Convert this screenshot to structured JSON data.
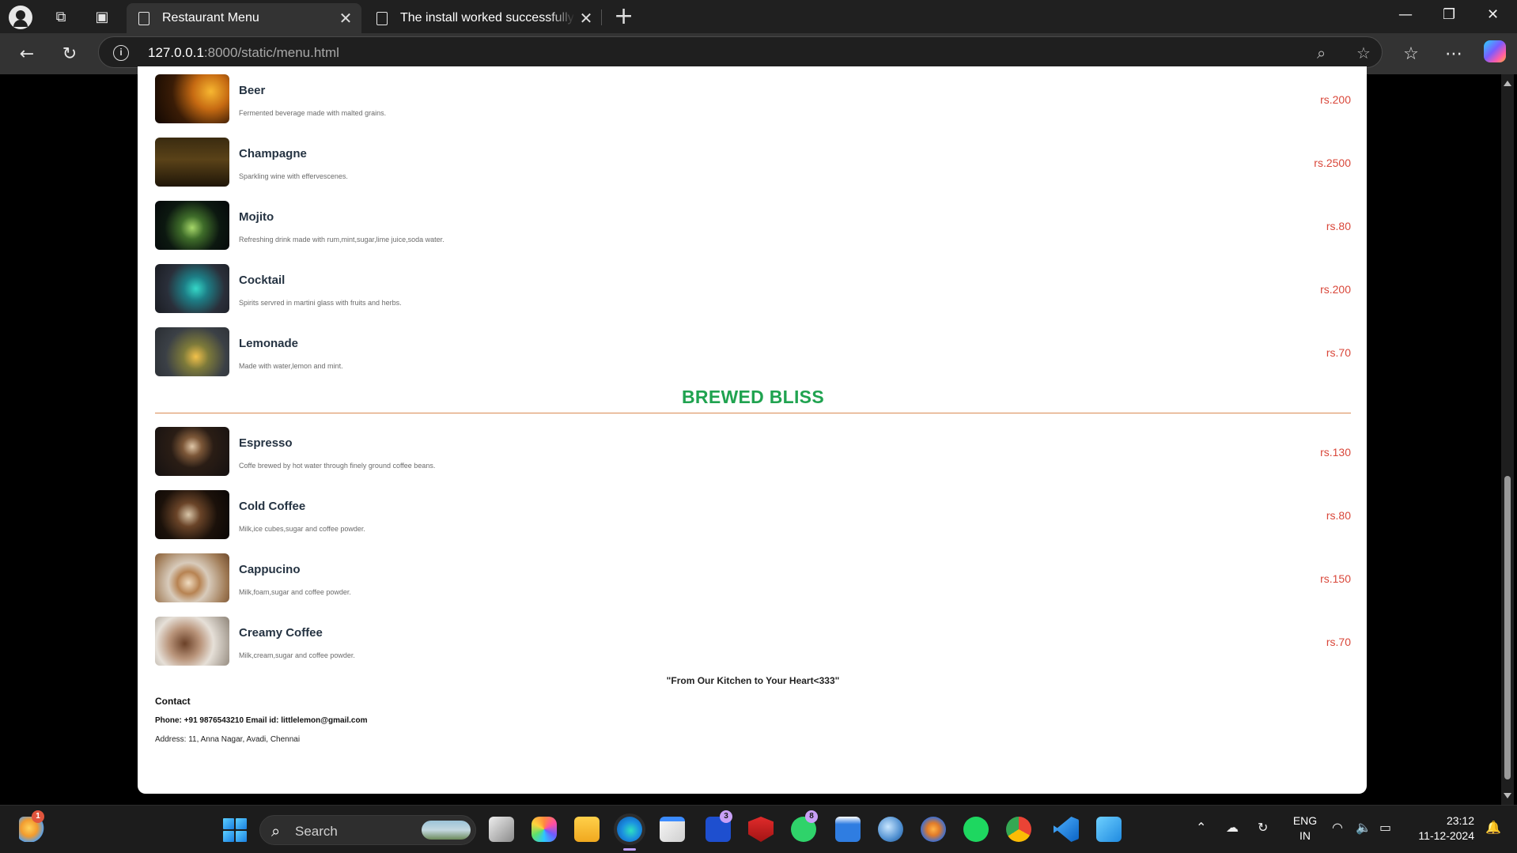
{
  "browser": {
    "tabs": [
      {
        "title": "Restaurant Menu",
        "active": true
      },
      {
        "title": "The install worked successfully! Congratulations!",
        "active": false
      }
    ],
    "url_host": "127.0.0.1",
    "url_rest": ":8000/static/menu.html"
  },
  "menu": {
    "drinks": [
      {
        "name": "Beer",
        "desc": "Fermented beverage made with malted grains.",
        "price": "rs.200"
      },
      {
        "name": "Champagne",
        "desc": "Sparkling wine with effervescenes.",
        "price": "rs.2500"
      },
      {
        "name": "Mojito",
        "desc": "Refreshing drink made with rum,mint,sugar,lime juice,soda water.",
        "price": "rs.80"
      },
      {
        "name": "Cocktail",
        "desc": "Spirits servred in martini glass with fruits and herbs.",
        "price": "rs.200"
      },
      {
        "name": "Lemonade",
        "desc": "Made with water,lemon and mint.",
        "price": "rs.70"
      }
    ],
    "section_title": "BREWED BLISS",
    "coffee": [
      {
        "name": "Espresso",
        "desc": "Coffe brewed by hot water through finely ground coffee beans.",
        "price": "rs.130"
      },
      {
        "name": "Cold Coffee",
        "desc": "Milk,ice cubes,sugar and coffee powder.",
        "price": "rs.80"
      },
      {
        "name": "Cappucino",
        "desc": "Milk,foam,sugar and coffee powder.",
        "price": "rs.150"
      },
      {
        "name": "Creamy Coffee",
        "desc": "Milk,cream,sugar and coffee powder.",
        "price": "rs.70"
      }
    ],
    "tagline": "\"From Our Kitchen to Your Heart<333\"",
    "contact_heading": "Contact",
    "contact_line": "Phone: +91 9876543210 Email id: littlelemon@gmail.com",
    "address_line": "Address: 11, Anna Nagar, Avadi, Chennai"
  },
  "taskbar": {
    "search_label": "Search",
    "weather_badge": "1",
    "teams_badge": "3",
    "whatsapp_badge": "8",
    "lang_top": "ENG",
    "lang_bottom": "IN",
    "time": "23:12",
    "date": "11-12-2024"
  }
}
